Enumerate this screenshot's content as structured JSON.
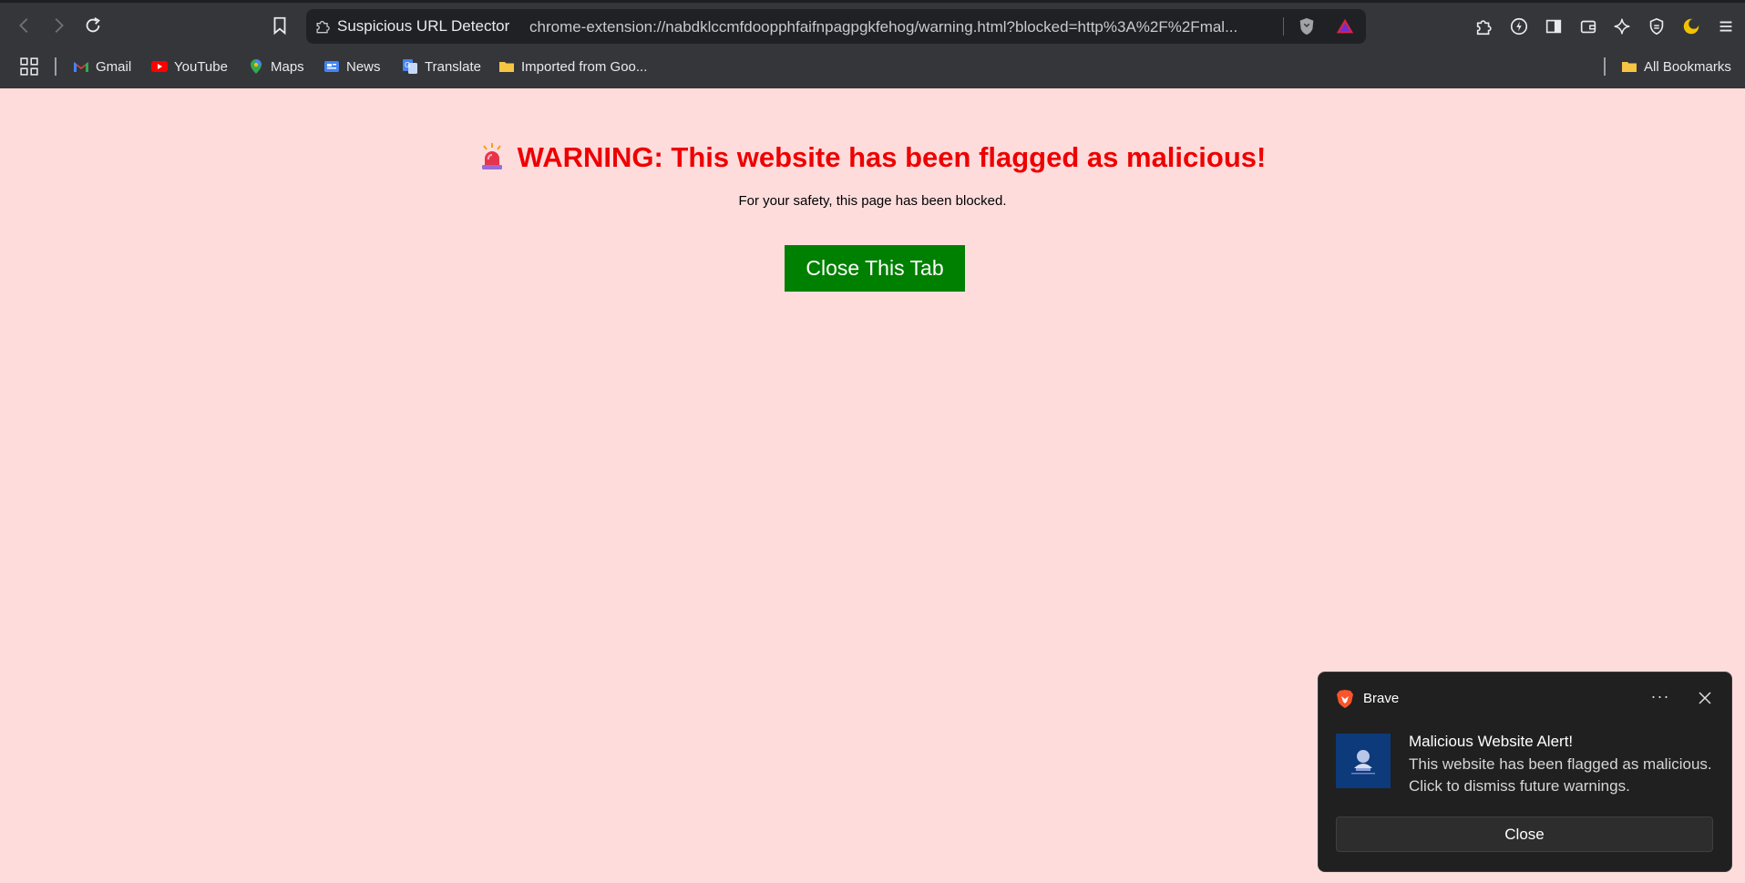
{
  "browser": {
    "site_name": "Suspicious URL Detector",
    "url": "chrome-extension://nabdklccmfdoopphfaifnpagpgkfehog/warning.html?blocked=http%3A%2F%2Fmal...",
    "bookmarks": [
      {
        "label": "Gmail",
        "icon": "gmail-icon"
      },
      {
        "label": "YouTube",
        "icon": "youtube-icon"
      },
      {
        "label": "Maps",
        "icon": "maps-icon"
      },
      {
        "label": "News",
        "icon": "news-icon"
      },
      {
        "label": "Translate",
        "icon": "translate-icon"
      },
      {
        "label": "Imported from Goo...",
        "icon": "folder-icon"
      }
    ],
    "all_bookmarks_label": "All Bookmarks"
  },
  "page": {
    "title": "WARNING: This website has been flagged as malicious!",
    "subtitle": "For your safety, this page has been blocked.",
    "close_button": "Close This Tab",
    "background": "#ffdcdc",
    "title_color": "#ee0000",
    "button_color": "#008000"
  },
  "notification": {
    "app_name": "Brave",
    "more_label": "···",
    "title": "Malicious Website Alert!",
    "body": "This website has been flagged as malicious. Click to dismiss future warnings.",
    "close_button": "Close"
  }
}
